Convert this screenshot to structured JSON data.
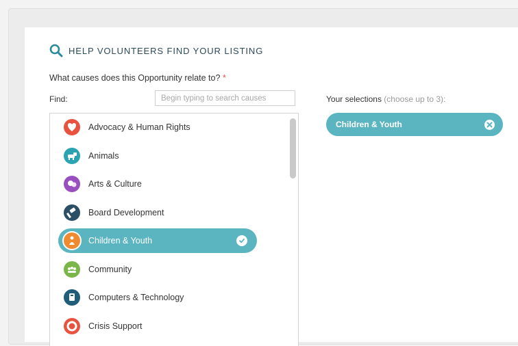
{
  "section": {
    "heading": "HELP VOLUNTEERS FIND YOUR LISTING",
    "question": "What causes does this Opportunity relate to?",
    "required_mark": "*"
  },
  "find": {
    "label": "Find:",
    "placeholder": "Begin typing to search causes",
    "value": ""
  },
  "causes": [
    {
      "label": "Advocacy & Human Rights",
      "icon": "heart-icon",
      "color": "#e8533f",
      "selected": false
    },
    {
      "label": "Animals",
      "icon": "dog-icon",
      "color": "#2ba3b3",
      "selected": false
    },
    {
      "label": "Arts & Culture",
      "icon": "masks-icon",
      "color": "#9a4fc0",
      "selected": false
    },
    {
      "label": "Board Development",
      "icon": "gavel-icon",
      "color": "#2c4f66",
      "selected": false
    },
    {
      "label": "Children & Youth",
      "icon": "child-icon",
      "color": "#f08a30",
      "selected": true
    },
    {
      "label": "Community",
      "icon": "people-icon",
      "color": "#7ab648",
      "selected": false
    },
    {
      "label": "Computers & Technology",
      "icon": "computer-icon",
      "color": "#1f5d78",
      "selected": false
    },
    {
      "label": "Crisis Support",
      "icon": "lifebuoy-icon",
      "color": "#e8533f",
      "selected": false
    }
  ],
  "selections": {
    "title": "Your selections",
    "hint": "(choose up to 3):",
    "items": [
      {
        "label": "Children & Youth"
      }
    ]
  },
  "colors": {
    "accent": "#5bb5c0",
    "heading": "#2b4a5a",
    "required": "#d9534f"
  }
}
